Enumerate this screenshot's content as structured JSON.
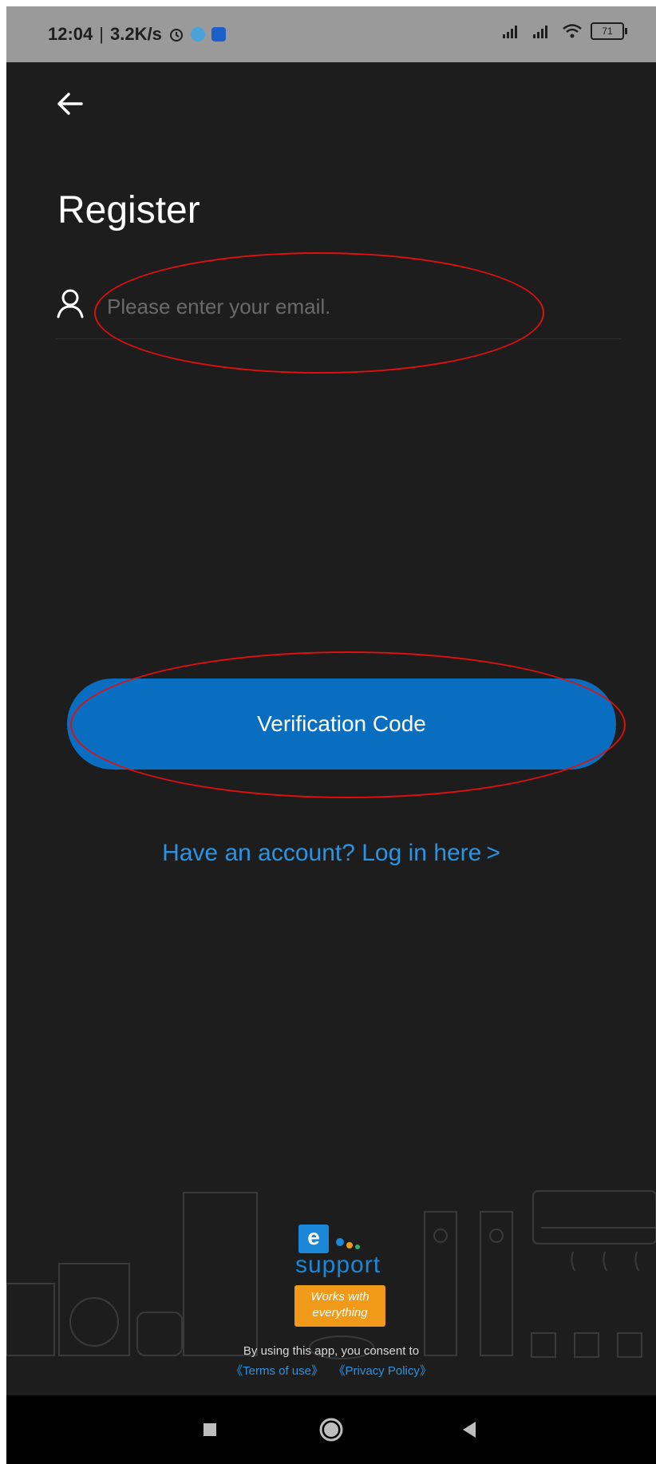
{
  "status_bar": {
    "time": "12:04",
    "net_speed": "3.2K/s",
    "battery": "71"
  },
  "header": {
    "title": "Register"
  },
  "form": {
    "email_placeholder": "Please enter your email.",
    "email_value": ""
  },
  "actions": {
    "verify_label": "Verification Code",
    "login_link": "Have an account? Log in here",
    "login_chevron": ">"
  },
  "footer": {
    "logo_e": "e",
    "logo_word": "support",
    "badge_line1": "Works with",
    "badge_line2": "everything",
    "consent": "By using this app, you consent to",
    "terms": "《Terms of use》",
    "privacy": "《Privacy Policy》"
  },
  "colors": {
    "background": "#1d1d1d",
    "accent": "#0a6ec0",
    "link": "#2b94e2",
    "badge": "#f19a1a",
    "annotation": "#e01010"
  },
  "icons": [
    "back-arrow-icon",
    "user-icon",
    "alarm-icon",
    "signal-icon",
    "wifi-icon",
    "battery-icon",
    "recents-icon",
    "home-icon",
    "back-icon"
  ]
}
